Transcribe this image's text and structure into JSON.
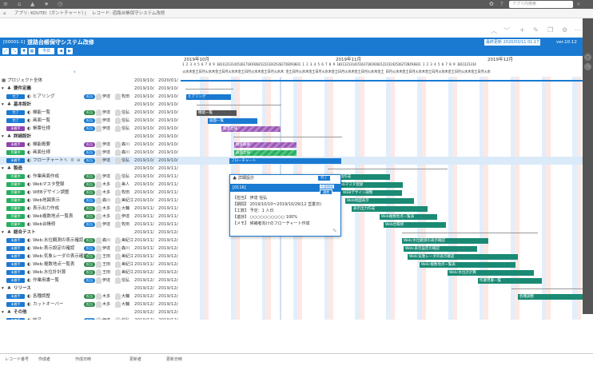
{
  "topbar": {
    "search_placeholder": "アプリ内検索"
  },
  "breadcrumb": {
    "app": "アプリ: KOUTEI（ガントチャート）",
    "separator": "|",
    "record": "レコード: 道路台帳保守システム改修"
  },
  "header": {
    "record_id": "[00001-1]",
    "title": "道路台帳保守システム改修",
    "version": "ver.10.12",
    "stamp": "最終更新 2020/03/11 01:17"
  },
  "controls": {
    "today_label": "今日",
    "back_label": "◀",
    "fwd_label": "▶"
  },
  "gantt": {
    "months": [
      "2019年10月",
      "2019年11月",
      "2019年12月"
    ],
    "days_line": "1 2 3 4 5 6 7 8 9 10111213141516171819202122232425262728293031 1 2 3 4 5 6 7 8 9 10111213141516171819202122232425262728293031 1 2 3 4 5 6 7 8 9 1011121314",
    "weekday_line": "火水木金土日月火水木金土日月火水木金土日月火水木金土日月火水木 金土日月火水木金土日月火水木金土日月火水木金土日月火水木金土 日月火水木金土日月火水木金土日月火水木金土日月火水木金土日月火水",
    "project_label": "プロジェクト全体",
    "rows": [
      {
        "type": "group",
        "label": "要件定義",
        "d1": "2019/10/",
        "d2": "2019/10/"
      },
      {
        "type": "task",
        "tag": "完了",
        "tagColor": "#1a7ad1",
        "label": "ヒアリング",
        "pill": "担当",
        "pillColor": "#1a7ad1",
        "p1": "伊達",
        "p2": "牧田",
        "d1": "2019/10/",
        "d2": "2019/10/"
      },
      {
        "type": "group",
        "label": "基本設計",
        "d1": "2019/10/",
        "d2": "2019/10/"
      },
      {
        "type": "task",
        "tag": "完了",
        "tagColor": "#1a7ad1",
        "label": "機能一覧",
        "pill": "担当",
        "pillColor": "#2c8a4a",
        "p1": "伊達",
        "p2": "信弘",
        "d1": "2019/10/",
        "d2": "2019/10/"
      },
      {
        "type": "task",
        "tag": "完了",
        "tagColor": "#1a7ad1",
        "label": "画面一覧",
        "pill": "担当",
        "pillColor": "#1a7ad1",
        "p1": "伊達",
        "p2": "信弘",
        "d1": "2019/10/",
        "d2": "2019/10/"
      },
      {
        "type": "task",
        "tag": "未着手",
        "tagColor": "#8e44ad",
        "label": "帳票仕様",
        "pill": "担当",
        "pillColor": "#1a7ad1",
        "p1": "伊達",
        "p2": "信弘",
        "d1": "2019/10/",
        "d2": "2019/10/"
      },
      {
        "type": "group",
        "label": "詳細設計",
        "d1": "2019/10/",
        "d2": "2019/10/"
      },
      {
        "type": "task",
        "tag": "未着手",
        "tagColor": "#8e44ad",
        "label": "機能概要",
        "pill": "担当",
        "pillColor": "#8e44ad",
        "p1": "伊達",
        "p2": "森川",
        "d1": "2019/10/",
        "d2": "2019/10/"
      },
      {
        "type": "task",
        "tag": "作業中",
        "tagColor": "#27ae60",
        "label": "画面仕様",
        "pill": "担当",
        "pillColor": "#1a7ad1",
        "p1": "伊達",
        "p2": "森川",
        "d1": "2019/10/",
        "d2": "2019/10/"
      },
      {
        "type": "task",
        "tag": "未着手",
        "tagColor": "#1a7ad1",
        "label": "フローチャート",
        "pill": "担当",
        "pillColor": "#1a7ad1",
        "p1": "伊達",
        "p2": "信弘",
        "d1": "2019/10/",
        "d2": "2019/10/",
        "selected": true
      },
      {
        "type": "group",
        "label": "製造",
        "d1": "2019/10/",
        "d2": "2019/11/"
      },
      {
        "type": "task",
        "tag": "作業中",
        "tagColor": "#27ae60",
        "label": "作業画面作成",
        "pill": "担当",
        "pillColor": "#2c8a4a",
        "p1": "伊達",
        "p2": "信弘",
        "d1": "2019/10/",
        "d2": "2019/11/"
      },
      {
        "type": "task",
        "tag": "作業中",
        "tagColor": "#27ae60",
        "label": "Webマスタ登録",
        "pill": "担当",
        "pillColor": "#2c8a4a",
        "p1": "木多",
        "p2": "美人",
        "d1": "2019/10/",
        "d2": "2019/11/"
      },
      {
        "type": "task",
        "tag": "作業中",
        "tagColor": "#27ae60",
        "label": "WEBデザイン調整",
        "pill": "担当",
        "pillColor": "#2c8a4a",
        "p1": "木多",
        "p2": "牧田",
        "d1": "2019/10/",
        "d2": "2019/11/"
      },
      {
        "type": "task",
        "tag": "作業中",
        "tagColor": "#27ae60",
        "label": "Web地図表示",
        "pill": "担当",
        "pillColor": "#1a7ad1",
        "p1": "森川",
        "p2": "美紀江",
        "d1": "2019/10/",
        "d2": "2019/11/"
      },
      {
        "type": "task",
        "tag": "作業中",
        "tagColor": "#27ae60",
        "label": "表示出力作成",
        "pill": "担当",
        "pillColor": "#2c8a4a",
        "p1": "木多",
        "p2": "大輔",
        "d1": "2019/11/",
        "d2": "2019/11/"
      },
      {
        "type": "task",
        "tag": "作業中",
        "tagColor": "#27ae60",
        "label": "Web複数地点一覧表",
        "pill": "担当",
        "pillColor": "#2c8a4a",
        "p1": "木多",
        "p2": "伊達",
        "d1": "2019/11/",
        "d2": "2019/11/"
      },
      {
        "type": "task",
        "tag": "作業中",
        "tagColor": "#27ae60",
        "label": "Web台帳修",
        "pill": "担当",
        "pillColor": "#1a7ad1",
        "p1": "伊達",
        "p2": "牧田",
        "d1": "2019/11/",
        "d2": "2019/11/"
      },
      {
        "type": "group",
        "label": "総合テスト",
        "d1": "2019/11/",
        "d2": "2019/12/"
      },
      {
        "type": "task",
        "tag": "未着手",
        "tagColor": "#1a7ad1",
        "label": "Web:水位観測の表示確認",
        "pill": "担当",
        "pillColor": "#2c8a4a",
        "p1": "森川",
        "p2": "美紀江",
        "d1": "2019/11/",
        "d2": "2019/12/"
      },
      {
        "type": "task",
        "tag": "未着手",
        "tagColor": "#1a7ad1",
        "label": "Web:表示設定の確認",
        "pill": "担当",
        "pillColor": "#1a7ad1",
        "p1": "伊達",
        "p2": "森川",
        "d1": "2019/11/",
        "d2": "2019/12/"
      },
      {
        "type": "task",
        "tag": "未着手",
        "tagColor": "#1a7ad1",
        "label": "Web:気象レーダの表示確認",
        "pill": "担当",
        "pillColor": "#2c8a4a",
        "p1": "王田",
        "p2": "美紀江",
        "d1": "2019/11/",
        "d2": "2019/12/"
      },
      {
        "type": "task",
        "tag": "未着手",
        "tagColor": "#1a7ad1",
        "label": "Web:複数地点一覧表",
        "pill": "担当",
        "pillColor": "#2c8a4a",
        "p1": "王田",
        "p2": "美紀江",
        "d1": "2019/11/",
        "d2": "2019/12/"
      },
      {
        "type": "task",
        "tag": "未着手",
        "tagColor": "#1a7ad1",
        "label": "Web:水位計計算",
        "pill": "担当",
        "pillColor": "#2c8a4a",
        "p1": "王田",
        "p2": "美紀江",
        "d1": "2019/12/",
        "d2": "2019/12/"
      },
      {
        "type": "task",
        "tag": "未着手",
        "tagColor": "#1a7ad1",
        "label": "作業用書一覧",
        "pill": "担当",
        "pillColor": "#1a7ad1",
        "p1": "伊達",
        "p2": "信弘",
        "d1": "2019/12/",
        "d2": "2019/12/"
      },
      {
        "type": "group",
        "label": "リリース",
        "d1": "2019/12/",
        "d2": "2019/12/"
      },
      {
        "type": "task",
        "tag": "未着手",
        "tagColor": "#1a7ad1",
        "label": "各種調整",
        "pill": "担当",
        "pillColor": "#2c8a4a",
        "p1": "木多",
        "p2": "大輔",
        "d1": "2019/12/",
        "d2": "2019/12/"
      },
      {
        "type": "task",
        "tag": "未着手",
        "tagColor": "#1a7ad1",
        "label": "カットオーバー",
        "pill": "担当",
        "pillColor": "#2c8a4a",
        "p1": "木多",
        "p2": "大輔",
        "d1": "2019/12/",
        "d2": "2019/12/"
      },
      {
        "type": "group",
        "label": "その他",
        "d1": "2019/12/",
        "d2": "2019/12/"
      },
      {
        "type": "task",
        "tag": "未着手",
        "tagColor": "#1a7ad1",
        "label": "納品",
        "pill": "担当",
        "pillColor": "#1a7ad1",
        "p1": "伊達",
        "p2": "信弘",
        "d1": "2019/12/",
        "d2": "2019/12/"
      }
    ],
    "project_dates": {
      "d1": "2019/10/",
      "d2": "2020/01/"
    },
    "bar_labels": [
      "ヒアリング",
      "機能一覧",
      "画面一覧",
      "帳票仕様",
      "機能概要",
      "画面仕様",
      "フローチャート",
      "作業画面作成",
      "Webマスタ登録",
      "WEBデザイン調整",
      "Web地図表示",
      "表示出力作成",
      "Web複数地点一覧表",
      "Web台帳修",
      "Web:水位観測の表示確認",
      "Web:表示設定の確認",
      "Web:気象レーダの表示確認",
      "Web:複数地点一覧表",
      "Web:水位計計算",
      "作業用書一覧",
      "各種調整"
    ]
  },
  "popup": {
    "header": "詳細設計",
    "header_badge": "完了",
    "id": "[0116]",
    "title": "フローチャート",
    "badge1": "任意期限",
    "badge2": "通常",
    "lines": [
      "【担当】 伊達 信弘",
      "【期間】 2019/10/10～2019/10/29(12 営業日)",
      "【工数】 予定：1 人日",
      "【進捗】 ○○○○○○○○○○ 100%",
      "【メモ】 候補者向けのフローチャート作成"
    ]
  },
  "footer": {
    "cols": [
      "レコード番号",
      "作成者",
      "作成日時",
      "更新者",
      "更新日時"
    ]
  }
}
